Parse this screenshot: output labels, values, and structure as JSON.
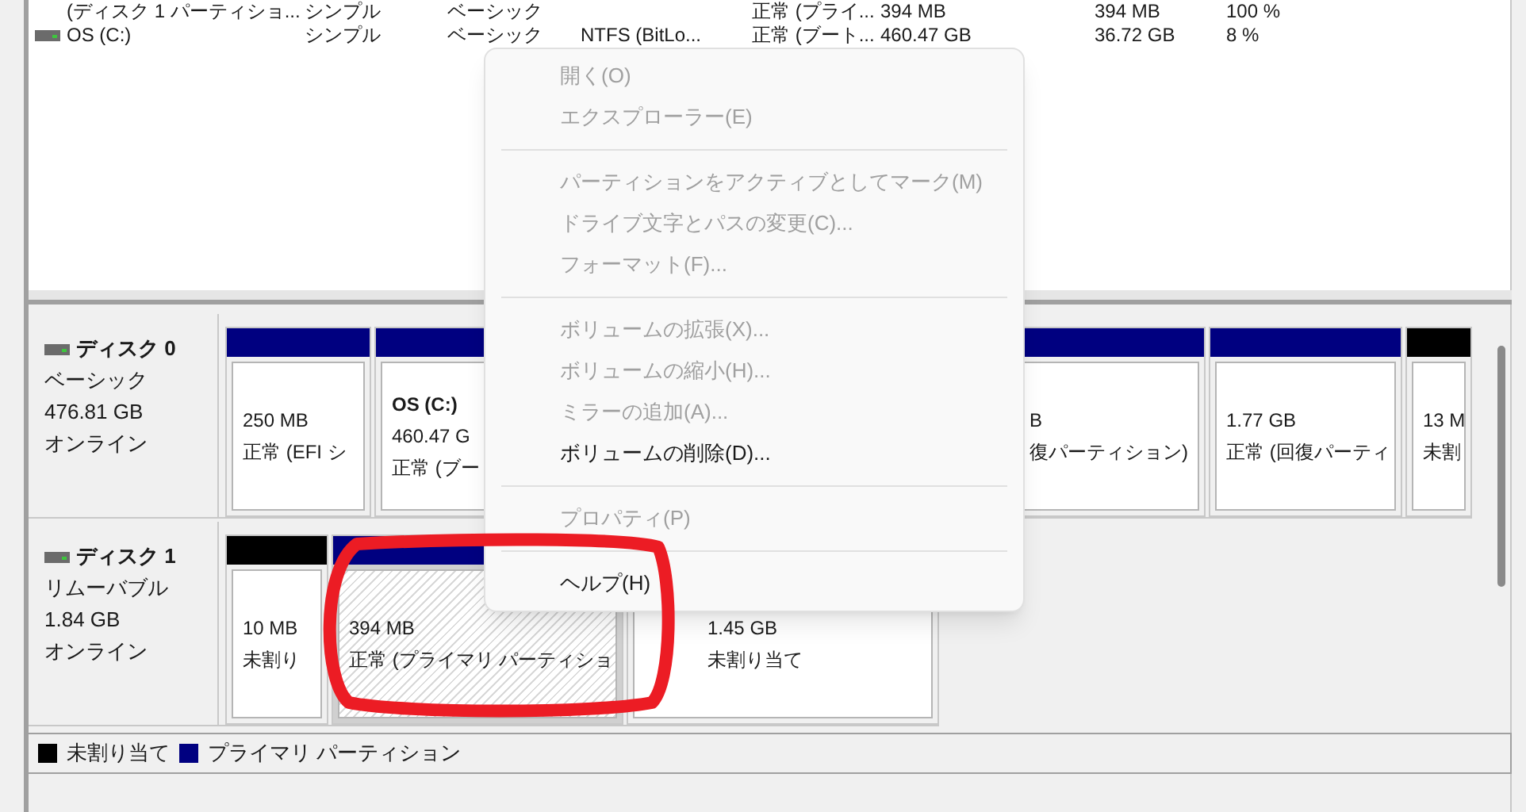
{
  "volumes": [
    {
      "name": "(ディスク 1 パーティショ...",
      "layout": "シンプル",
      "type": "ベーシック",
      "status": "正常 (プライ...",
      "capacity": "394 MB",
      "free": "394 MB",
      "pct": "100 %"
    },
    {
      "name": "OS (C:)",
      "layout": "シンプル",
      "type": "ベーシック",
      "fs": "NTFS (BitLo...",
      "status": "正常 (ブート...",
      "capacity": "460.47 GB",
      "free": "36.72 GB",
      "pct": "8 %"
    }
  ],
  "disks": [
    {
      "name": "ディスク 0",
      "kind": "ベーシック",
      "size": "476.81 GB",
      "state": "オンライン",
      "partitions": [
        {
          "kind": "primary",
          "selected": false,
          "lines": [
            "250 MB",
            "正常 (EFI シ"
          ]
        },
        {
          "kind": "primary",
          "selected": false,
          "title": "OS  (C:)",
          "lines": [
            "460.47 G",
            "正常 (ブー"
          ]
        },
        {
          "kind": "primary",
          "selected": false,
          "lines": [
            "B",
            "復パーティション)"
          ]
        },
        {
          "kind": "primary",
          "selected": false,
          "lines": [
            "1.77 GB",
            "正常 (回復パーティ"
          ]
        },
        {
          "kind": "unallocated",
          "selected": false,
          "lines": [
            "13 M",
            "未割"
          ]
        }
      ]
    },
    {
      "name": "ディスク 1",
      "kind": "リムーバブル",
      "size": "1.84 GB",
      "state": "オンライン",
      "partitions": [
        {
          "kind": "unallocated",
          "selected": false,
          "lines": [
            "10 MB",
            "未割り"
          ]
        },
        {
          "kind": "primary",
          "selected": true,
          "lines": [
            "394 MB",
            "正常 (プライマリ パーティショ"
          ]
        },
        {
          "kind": "unallocated",
          "selected": false,
          "lines": [
            "1.45 GB",
            "未割り当て"
          ]
        }
      ]
    }
  ],
  "legend": [
    {
      "kind": "unallocated",
      "label": "未割り当て"
    },
    {
      "kind": "primary",
      "label": "プライマリ パーティション"
    }
  ],
  "menu": [
    {
      "kind": "item",
      "label": "開く(O)",
      "disabled": true
    },
    {
      "kind": "item",
      "label": "エクスプローラー(E)",
      "disabled": true
    },
    {
      "kind": "separator"
    },
    {
      "kind": "item",
      "label": "パーティションをアクティブとしてマーク(M)",
      "disabled": true
    },
    {
      "kind": "item",
      "label": "ドライブ文字とパスの変更(C)...",
      "disabled": true
    },
    {
      "kind": "item",
      "label": "フォーマット(F)...",
      "disabled": true
    },
    {
      "kind": "separator"
    },
    {
      "kind": "item",
      "label": "ボリュームの拡張(X)...",
      "disabled": true
    },
    {
      "kind": "item",
      "label": "ボリュームの縮小(H)...",
      "disabled": true
    },
    {
      "kind": "item",
      "label": "ミラーの追加(A)...",
      "disabled": true
    },
    {
      "kind": "item",
      "label": "ボリュームの削除(D)...",
      "disabled": false
    },
    {
      "kind": "separator"
    },
    {
      "kind": "item",
      "label": "プロパティ(P)",
      "disabled": true
    },
    {
      "kind": "separator"
    },
    {
      "kind": "item",
      "label": "ヘルプ(H)",
      "disabled": false
    }
  ]
}
